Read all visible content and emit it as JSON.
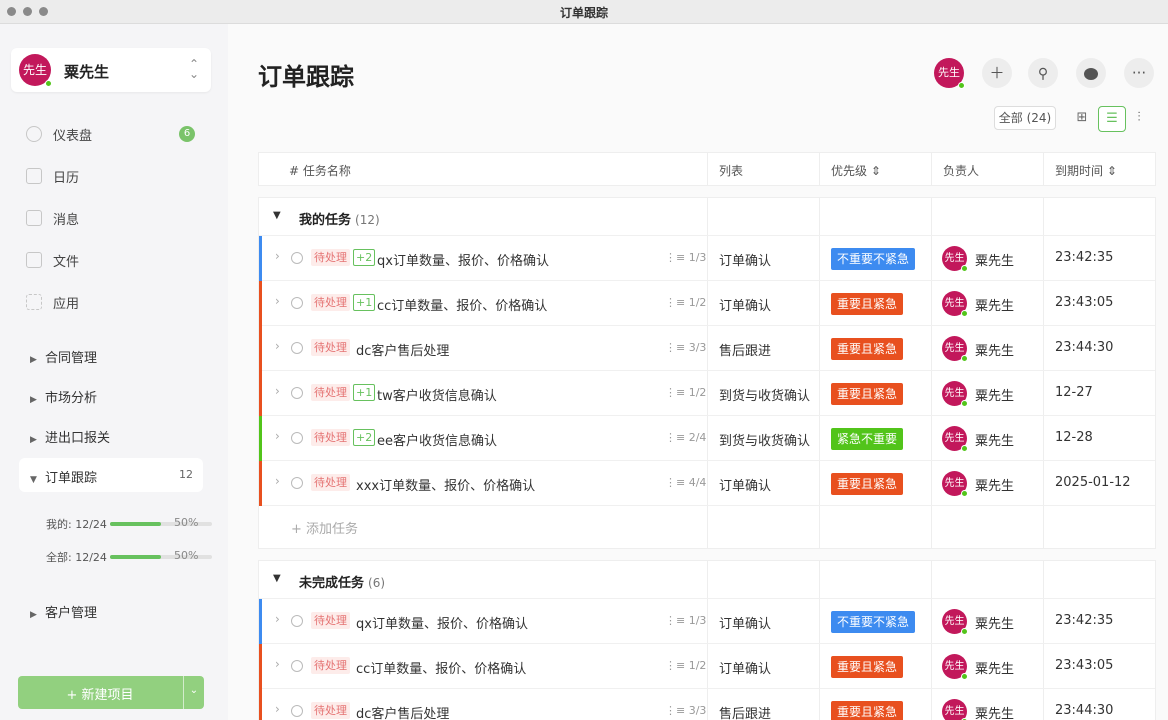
{
  "window": {
    "title": "订单跟踪"
  },
  "colors": {
    "accent": "#67c15e",
    "blue": "#3d8bf0",
    "red": "#e8501f",
    "green": "#52c41a",
    "avatar": "#c2185b"
  },
  "sidebar": {
    "user": {
      "avatar_text": "先生",
      "name": "粟先生"
    },
    "nav": [
      {
        "label": "仪表盘",
        "icon": "dashboard-icon",
        "badge": "6"
      },
      {
        "label": "日历",
        "icon": "calendar-icon"
      },
      {
        "label": "消息",
        "icon": "message-icon"
      },
      {
        "label": "文件",
        "icon": "file-icon"
      },
      {
        "label": "应用",
        "icon": "apps-icon"
      }
    ],
    "groups": [
      "合同管理",
      "市场分析",
      "进出口报关"
    ],
    "active_group": {
      "label": "订单跟踪",
      "count": "12"
    },
    "progress": [
      {
        "label": "我的: 12/24",
        "value": 0.5,
        "pct": "50%"
      },
      {
        "label": "全部: 12/24",
        "value": 0.5,
        "pct": "50%"
      }
    ],
    "group_after": "客户管理",
    "new_button": "+ 新建项目"
  },
  "header": {
    "title": "订单跟踪",
    "avatar_text": "先生",
    "filter_all": "全部 (24)"
  },
  "columns": [
    "# 任务名称",
    "列表",
    "优先级 ⇕",
    "负责人",
    "到期时间 ⇕"
  ],
  "sections": [
    {
      "title": "我的任务",
      "count": "(12)",
      "add_label": "+ 添加任务",
      "rows": [
        {
          "status": "待处理",
          "plus": "+2",
          "name": "qx订单数量、报价、价格确认",
          "sub": "⋮≡ 1/3",
          "list": "订单确认",
          "priority": "不重要不紧急",
          "prio_color": "#3d8bf0",
          "bar": "#3d8bf0",
          "owner_av": "先生",
          "owner": "粟先生",
          "due": "23:42:35"
        },
        {
          "status": "待处理",
          "plus": "+1",
          "name": "cc订单数量、报价、价格确认",
          "sub": "⋮≡ 1/2",
          "list": "订单确认",
          "priority": "重要且紧急",
          "prio_color": "#e8501f",
          "bar": "#e8501f",
          "owner_av": "先生",
          "owner": "粟先生",
          "due": "23:43:05"
        },
        {
          "status": "待处理",
          "plus": "",
          "name": "dc客户售后处理",
          "sub": "⋮≡ 3/3",
          "list": "售后跟进",
          "priority": "重要且紧急",
          "prio_color": "#e8501f",
          "bar": "#e8501f",
          "owner_av": "先生",
          "owner": "粟先生",
          "due": "23:44:30"
        },
        {
          "status": "待处理",
          "plus": "+1",
          "name": "tw客户收货信息确认",
          "sub": "⋮≡ 1/2",
          "list": "到货与收货确认",
          "priority": "重要且紧急",
          "prio_color": "#e8501f",
          "bar": "#e8501f",
          "owner_av": "先生",
          "owner": "粟先生",
          "due": "12-27"
        },
        {
          "status": "待处理",
          "plus": "+2",
          "name": "ee客户收货信息确认",
          "sub": "⋮≡ 2/4",
          "list": "到货与收货确认",
          "priority": "紧急不重要",
          "prio_color": "#52c41a",
          "bar": "#52c41a",
          "owner_av": "先生",
          "owner": "粟先生",
          "due": "12-28"
        },
        {
          "status": "待处理",
          "plus": "",
          "name": "xxx订单数量、报价、价格确认",
          "sub": "⋮≡ 4/4",
          "list": "订单确认",
          "priority": "重要且紧急",
          "prio_color": "#e8501f",
          "bar": "#e8501f",
          "owner_av": "先生",
          "owner": "粟先生",
          "due": "2025-01-12"
        }
      ]
    },
    {
      "title": "未完成任务",
      "count": "(6)",
      "add_label": "",
      "rows": [
        {
          "status": "待处理",
          "plus": "",
          "name": "qx订单数量、报价、价格确认",
          "sub": "⋮≡ 1/3",
          "list": "订单确认",
          "priority": "不重要不紧急",
          "prio_color": "#3d8bf0",
          "bar": "#3d8bf0",
          "owner_av": "先生",
          "owner": "粟先生",
          "due": "23:42:35"
        },
        {
          "status": "待处理",
          "plus": "",
          "name": "cc订单数量、报价、价格确认",
          "sub": "⋮≡ 1/2",
          "list": "订单确认",
          "priority": "重要且紧急",
          "prio_color": "#e8501f",
          "bar": "#e8501f",
          "owner_av": "先生",
          "owner": "粟先生",
          "due": "23:43:05"
        },
        {
          "status": "待处理",
          "plus": "",
          "name": "dc客户售后处理",
          "sub": "⋮≡ 3/3",
          "list": "售后跟进",
          "priority": "重要且紧急",
          "prio_color": "#e8501f",
          "bar": "#e8501f",
          "owner_av": "先生",
          "owner": "粟先生",
          "due": "23:44:30"
        }
      ]
    }
  ]
}
